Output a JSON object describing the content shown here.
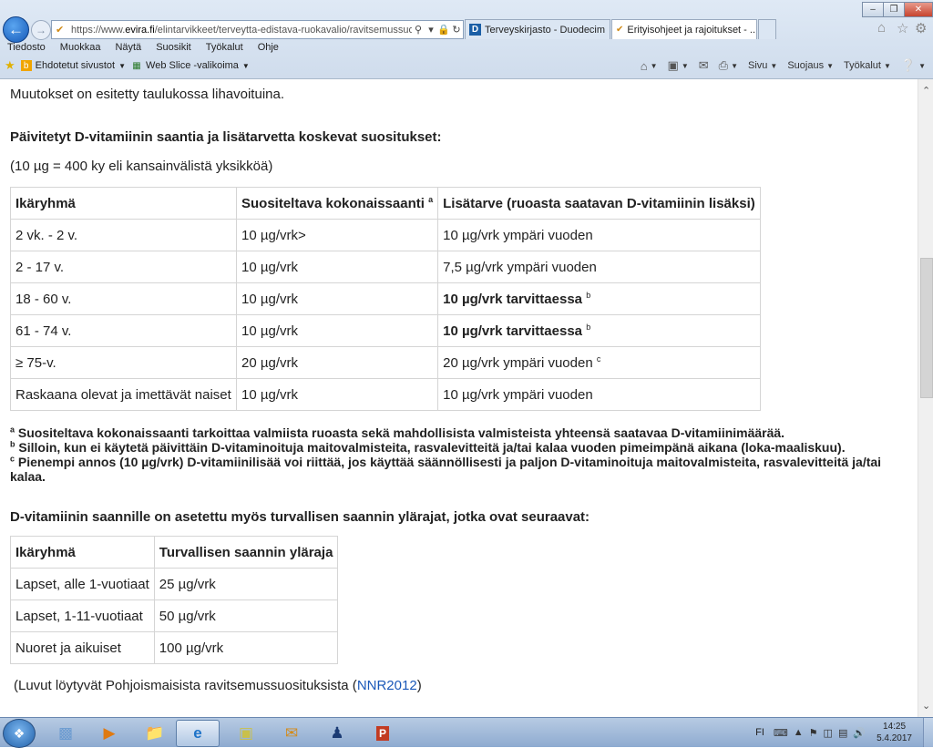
{
  "browser": {
    "url_prefix": "https://www.",
    "url_domain": "evira.fi",
    "url_path": "/elintarvikkeet/terveytta-edistava-ruokavalio/ravitsemussuositukset/",
    "tabs": [
      {
        "label": "Terveyskirjasto - Duodecim"
      },
      {
        "label": "Erityisohjeet ja rajoitukset - ..."
      }
    ],
    "menu": [
      "Tiedosto",
      "Muokkaa",
      "Näytä",
      "Suosikit",
      "Työkalut",
      "Ohje"
    ],
    "favorites": {
      "suggested": "Ehdotetut sivustot",
      "webslice": "Web Slice -valikoima"
    },
    "commandbar": {
      "page": "Sivu",
      "safety": "Suojaus",
      "tools": "Työkalut"
    }
  },
  "page": {
    "changes_note": "Muutokset on esitetty taulukossa  lihavoituina.",
    "updated_heading": "Päivitetyt D-vitamiinin saantia ja lisätarvetta koskevat suositukset:",
    "unit_note": "(10 µg = 400 ky eli kansainvälistä yksikköä)",
    "table1": {
      "headers": {
        "age": "Ikäryhmä",
        "total": "Suositeltava kokonaissaanti",
        "total_sup": "a",
        "extra": "Lisätarve (ruoasta saatavan D-vitamiinin lisäksi)"
      },
      "rows": [
        {
          "age": "2 vk. - 2 v.",
          "total": "10 µg/vrk>",
          "extra": "10  µg/vrk ympäri vuoden",
          "sup": ""
        },
        {
          "age": "2 - 17 v.",
          "total": "10  µg/vrk",
          "extra": "7,5  µg/vrk ympäri vuoden",
          "sup": ""
        },
        {
          "age": "18 - 60 v.",
          "total": "10  µg/vrk",
          "extra": "10  µg/vrk tarvittaessa",
          "sup": "b"
        },
        {
          "age": "61 - 74 v.",
          "total": "10  µg/vrk",
          "extra": "10 µg/vrk tarvittaessa",
          "sup": "b"
        },
        {
          "age": "≥ 75-v.",
          "total": "20  µg/vrk",
          "extra": "20 µg/vrk ympäri vuoden",
          "sup": "c"
        },
        {
          "age": "Raskaana olevat ja imettävät naiset",
          "total": "10  µg/vrk",
          "extra": "10 µg/vrk ympäri vuoden",
          "sup": ""
        }
      ]
    },
    "footnotes": [
      {
        "mark": "a",
        "text": " Suositeltava kokonaissaanti tarkoittaa valmiista ruoasta sekä mahdollisista valmisteista yhteensä saatavaa D-vitamiinimäärää."
      },
      {
        "mark": "b",
        "text": " Silloin, kun ei käytetä päivittäin D-vitaminoituja maitovalmisteita, rasvalevitteitä ja/tai kalaa vuoden pimeimpänä aikana (loka-maaliskuu)."
      },
      {
        "mark": "c",
        "text": " Pienempi annos (10 µg/vrk) D-vitamiinilisää voi riittää, jos käyttää säännöllisesti ja paljon D-vitaminoituja maitovalmisteita, rasvalevitteitä ja/tai kalaa."
      }
    ],
    "limits_heading": "D-vitamiinin saannille on asetettu myös turvallisen saannin ylärajat, jotka ovat seuraavat:",
    "table2": {
      "headers": {
        "age": "Ikäryhmä",
        "limit": "Turvallisen saannin yläraja"
      },
      "rows": [
        {
          "age": "Lapset, alle 1-vuotiaat",
          "limit": "25 µg/vrk"
        },
        {
          "age": "Lapset, 1-11-vuotiaat",
          "limit": "50 µg/vrk"
        },
        {
          "age": "Nuoret ja aikuiset",
          "limit": "100 µg/vrk"
        }
      ]
    },
    "source_prefix": "(Luvut löytyvät Pohjoismaisista ravitsemussuosituksista (",
    "source_link": "NNR2012",
    "source_suffix": ")"
  },
  "taskbar": {
    "language": "FI",
    "time": "14:25",
    "date": "5.4.2017"
  }
}
